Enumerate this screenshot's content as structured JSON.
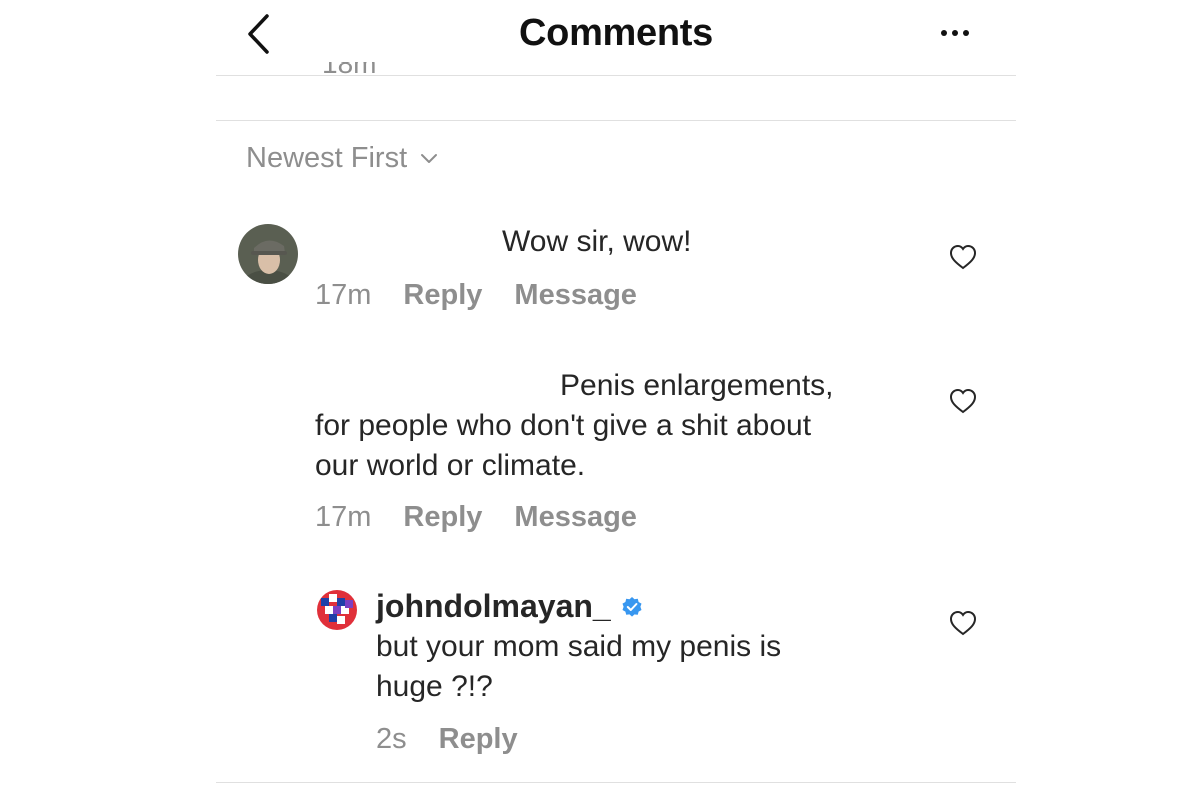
{
  "header": {
    "title": "Comments",
    "back_icon": "chevron-left-icon",
    "more_icon": "more-horizontal-icon"
  },
  "clipped_previous_time": "18m",
  "sort": {
    "label": "Newest First",
    "icon": "chevron-down-icon"
  },
  "comments": [
    {
      "text": "Wow sir, wow!",
      "time": "17m",
      "reply_label": "Reply",
      "message_label": "Message"
    },
    {
      "text_line1": "Penis enlargements,",
      "text_line2": "for people who don't give a shit about",
      "text_line3": "our world or climate.",
      "time": "17m",
      "reply_label": "Reply",
      "message_label": "Message"
    },
    {
      "username": "johndolmayan_",
      "verified_icon": "verified-badge-icon",
      "text_line1": "but your mom said my penis is",
      "text_line2": "huge ?!?",
      "time": "2s",
      "reply_label": "Reply"
    }
  ],
  "colors": {
    "text": "#262626",
    "secondary": "#8e8e8e",
    "verified": "#3897f0",
    "divider": "#e0e0e0"
  }
}
